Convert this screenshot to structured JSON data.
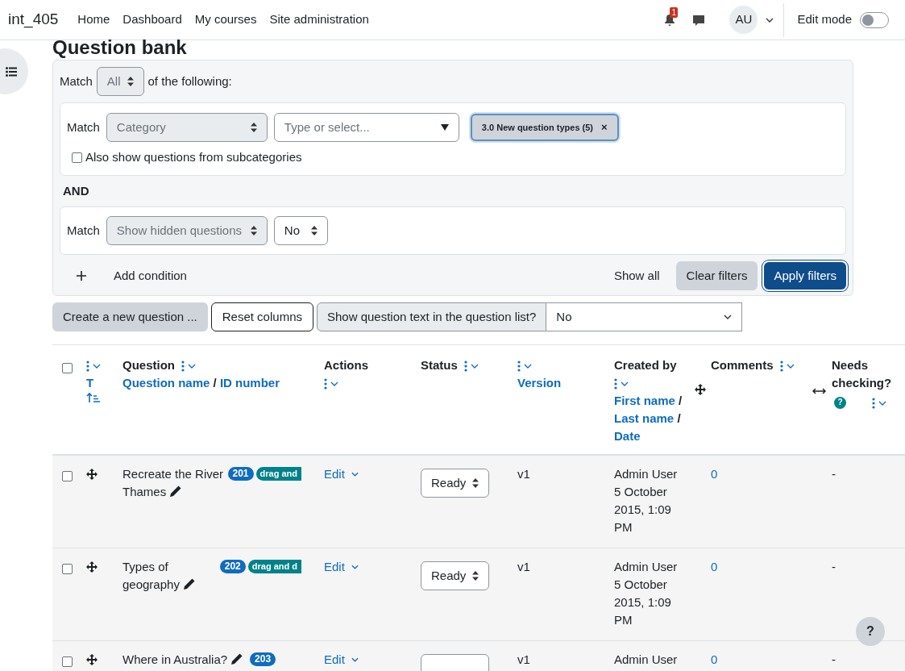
{
  "header": {
    "site": "int_405",
    "nav": [
      "Home",
      "Dashboard",
      "My courses",
      "Site administration"
    ],
    "notification_count": "1",
    "avatar": "AU",
    "edit_mode": {
      "label": "Edit mode",
      "on": false
    }
  },
  "title": "Question bank",
  "filters": {
    "match_label": "Match",
    "match_value": "All",
    "match_suffix": "of the following:",
    "category": {
      "match_label": "Match",
      "field": "Category",
      "placeholder": "Type or select...",
      "chip": "3.0 New question types (5)",
      "chip_close": "×",
      "subcategories": {
        "label": "Also show questions from subcategories",
        "checked": false
      }
    },
    "joiner": "AND",
    "hidden": {
      "match_label": "Match",
      "field": "Show hidden questions",
      "value": "No"
    },
    "add_condition": "Add condition",
    "show_all": "Show all",
    "clear_filters": "Clear filters",
    "apply_filters": "Apply filters"
  },
  "toolbar": {
    "create": "Create a new question ...",
    "reset": "Reset columns",
    "show_text_label": "Show question text in the question list?",
    "show_text_value": "No"
  },
  "table": {
    "select_all_checked": false,
    "type_sort": "T",
    "question": {
      "title": "Question",
      "sort_a": "Question name",
      "sep": "/",
      "sort_b": "ID number"
    },
    "actions": "Actions",
    "status": "Status",
    "version": "Version",
    "created_by": {
      "title": "Created by",
      "links": [
        "First name",
        "Last name",
        "Date"
      ],
      "sep": "/"
    },
    "comments": "Comments",
    "needs_checking": "Needs checking?",
    "needs_checking_help": "?",
    "rows": [
      {
        "checked": false,
        "name": "Recreate the River Thames",
        "id": "201",
        "type": "drag and",
        "action": "Edit",
        "status": "Ready",
        "version": "v1",
        "creator": "Admin User",
        "date": "5 October 2015, 1:09 PM",
        "comments": "0",
        "needs": "-"
      },
      {
        "checked": false,
        "name": "Types of geography",
        "id": "202",
        "type": "drag and d",
        "action": "Edit",
        "status": "Ready",
        "version": "v1",
        "creator": "Admin User",
        "date": "5 October 2015, 1:09 PM",
        "comments": "0",
        "needs": "-"
      },
      {
        "checked": false,
        "name": "Where in Australia?",
        "id": "203",
        "action": "Edit",
        "version": "v1",
        "creator": "Admin User",
        "comments": "0",
        "needs": "-"
      }
    ]
  },
  "help": "?"
}
